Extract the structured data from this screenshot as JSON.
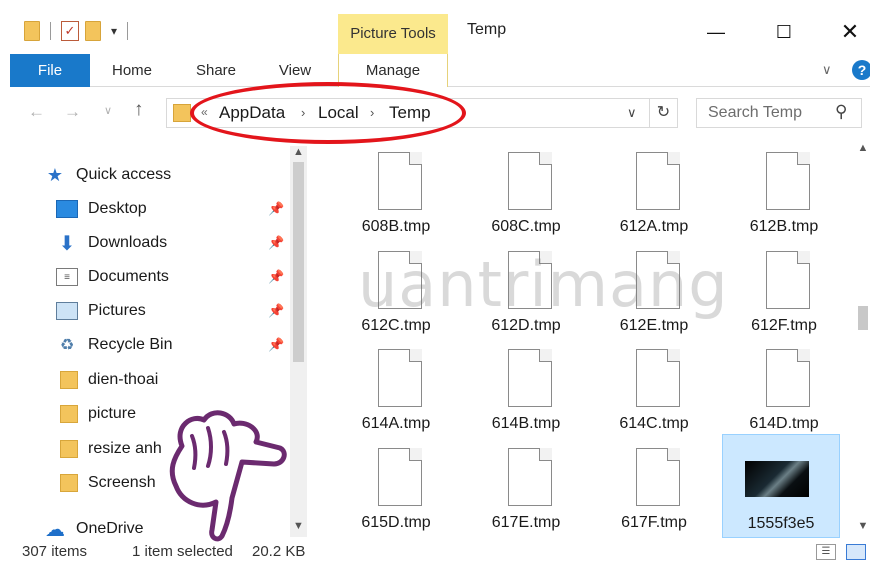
{
  "window": {
    "title": "Temp",
    "contextual_group": "Picture Tools",
    "controls": {
      "minimize": "—",
      "maximize": "☐",
      "close": "✕"
    }
  },
  "ribbon": {
    "tabs": [
      {
        "label": "File"
      },
      {
        "label": "Home"
      },
      {
        "label": "Share"
      },
      {
        "label": "View"
      },
      {
        "label": "Manage"
      }
    ],
    "help": "?"
  },
  "address": {
    "overflow": "«",
    "crumbs": [
      "AppData",
      "Local",
      "Temp"
    ],
    "separator": "›"
  },
  "search": {
    "placeholder": "Search Temp"
  },
  "nav": {
    "items": [
      {
        "label": "Quick access",
        "icon": "star-icon"
      },
      {
        "label": "Desktop",
        "icon": "desktop-icon",
        "pinned": true
      },
      {
        "label": "Downloads",
        "icon": "download-arrow-icon",
        "pinned": true
      },
      {
        "label": "Documents",
        "icon": "documents-icon",
        "pinned": true
      },
      {
        "label": "Pictures",
        "icon": "pictures-icon",
        "pinned": true
      },
      {
        "label": "Recycle Bin",
        "icon": "recycle-bin-icon",
        "pinned": true
      },
      {
        "label": "dien-thoai",
        "icon": "folder-icon"
      },
      {
        "label": "picture",
        "icon": "folder-icon"
      },
      {
        "label": "resize anh",
        "icon": "folder-icon"
      },
      {
        "label": "Screensh",
        "icon": "folder-icon"
      },
      {
        "label": "OneDrive",
        "icon": "onedrive-cloud-icon"
      }
    ]
  },
  "files": [
    "608B.tmp",
    "608C.tmp",
    "612A.tmp",
    "612B.tmp",
    "612C.tmp",
    "612D.tmp",
    "612E.tmp",
    "612F.tmp",
    "614A.tmp",
    "614B.tmp",
    "614C.tmp",
    "614D.tmp",
    "615D.tmp",
    "617E.tmp",
    "617F.tmp",
    "1555f3e5"
  ],
  "selected_file": "1555f3e5",
  "watermark": "uantrimang",
  "status": {
    "item_count": "307 items",
    "selection": "1 item selected",
    "size": "20.2 KB"
  },
  "colors": {
    "accent": "#1979ca",
    "highlight_ring": "#e3151b",
    "picture_tools": "#fbe98d",
    "selection": "#cce8ff",
    "hand_outline": "#6b2a6f"
  }
}
